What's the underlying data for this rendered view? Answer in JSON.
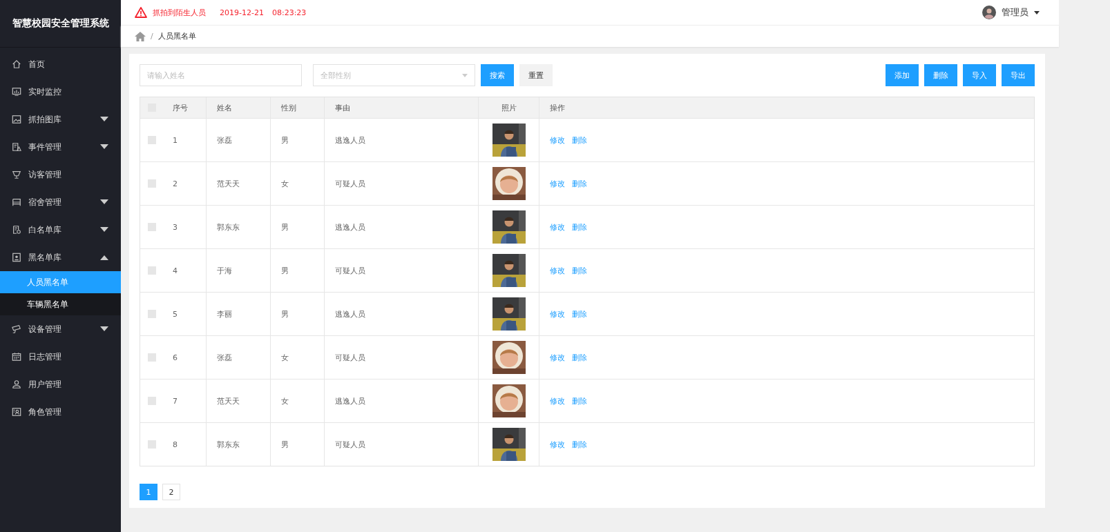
{
  "app_title": "智慧校园安全管理系统",
  "alert": {
    "message": "抓拍到陌生人员",
    "date": "2019-12-21",
    "time": "08:23:23"
  },
  "user": {
    "name": "管理员"
  },
  "breadcrumb": {
    "separator": "/",
    "items": [
      "人员黑名单"
    ]
  },
  "sidebar": {
    "items": [
      {
        "kind": "link",
        "label": "首页"
      },
      {
        "kind": "link",
        "label": "实时监控"
      },
      {
        "kind": "group",
        "label": "抓拍图库",
        "expanded": false
      },
      {
        "kind": "group",
        "label": "事件管理",
        "expanded": false
      },
      {
        "kind": "link",
        "label": "访客管理"
      },
      {
        "kind": "group",
        "label": "宿舍管理",
        "expanded": false
      },
      {
        "kind": "group",
        "label": "白名单库",
        "expanded": false
      },
      {
        "kind": "group",
        "label": "黑名单库",
        "expanded": true,
        "children": [
          {
            "label": "人员黑名单",
            "selected": true
          },
          {
            "label": "车辆黑名单",
            "selected": false
          }
        ]
      },
      {
        "kind": "group",
        "label": "设备管理",
        "expanded": false
      },
      {
        "kind": "link",
        "label": "日志管理"
      },
      {
        "kind": "link",
        "label": "用户管理"
      },
      {
        "kind": "link",
        "label": "角色管理"
      }
    ]
  },
  "filters": {
    "name_placeholder": "请输入姓名",
    "gender_placeholder": "全部性别",
    "search": "搜索",
    "reset": "重置"
  },
  "actions": [
    "添加",
    "删除",
    "导入",
    "导出"
  ],
  "table": {
    "columns": [
      "序号",
      "姓名",
      "性别",
      "事由",
      "照片",
      "操作"
    ],
    "header_checked": false,
    "rows": [
      {
        "checked": false,
        "no": "1",
        "name": "张磊",
        "gender": "男",
        "reason": "逃逸人员",
        "ops": [
          "修改",
          "删除"
        ]
      },
      {
        "checked": false,
        "no": "2",
        "name": "范天天",
        "gender": "女",
        "reason": "可疑人员",
        "ops": [
          "修改",
          "删除"
        ]
      },
      {
        "checked": false,
        "no": "3",
        "name": "郭东东",
        "gender": "男",
        "reason": "逃逸人员",
        "ops": [
          "修改",
          "删除"
        ]
      },
      {
        "checked": false,
        "no": "4",
        "name": "于海",
        "gender": "男",
        "reason": "可疑人员",
        "ops": [
          "修改",
          "删除"
        ]
      },
      {
        "checked": false,
        "no": "5",
        "name": "李丽",
        "gender": "男",
        "reason": "逃逸人员",
        "ops": [
          "修改",
          "删除"
        ]
      },
      {
        "checked": false,
        "no": "6",
        "name": "张磊",
        "gender": "女",
        "reason": "可疑人员",
        "ops": [
          "修改",
          "删除"
        ]
      },
      {
        "checked": false,
        "no": "7",
        "name": "范天天",
        "gender": "女",
        "reason": "逃逸人员",
        "ops": [
          "修改",
          "删除"
        ]
      },
      {
        "checked": false,
        "no": "8",
        "name": "郭东东",
        "gender": "男",
        "reason": "可疑人员",
        "ops": [
          "修改",
          "删除"
        ]
      }
    ]
  },
  "pagination": [
    {
      "label": "1",
      "selected": true
    },
    {
      "label": "2",
      "selected": false
    }
  ]
}
